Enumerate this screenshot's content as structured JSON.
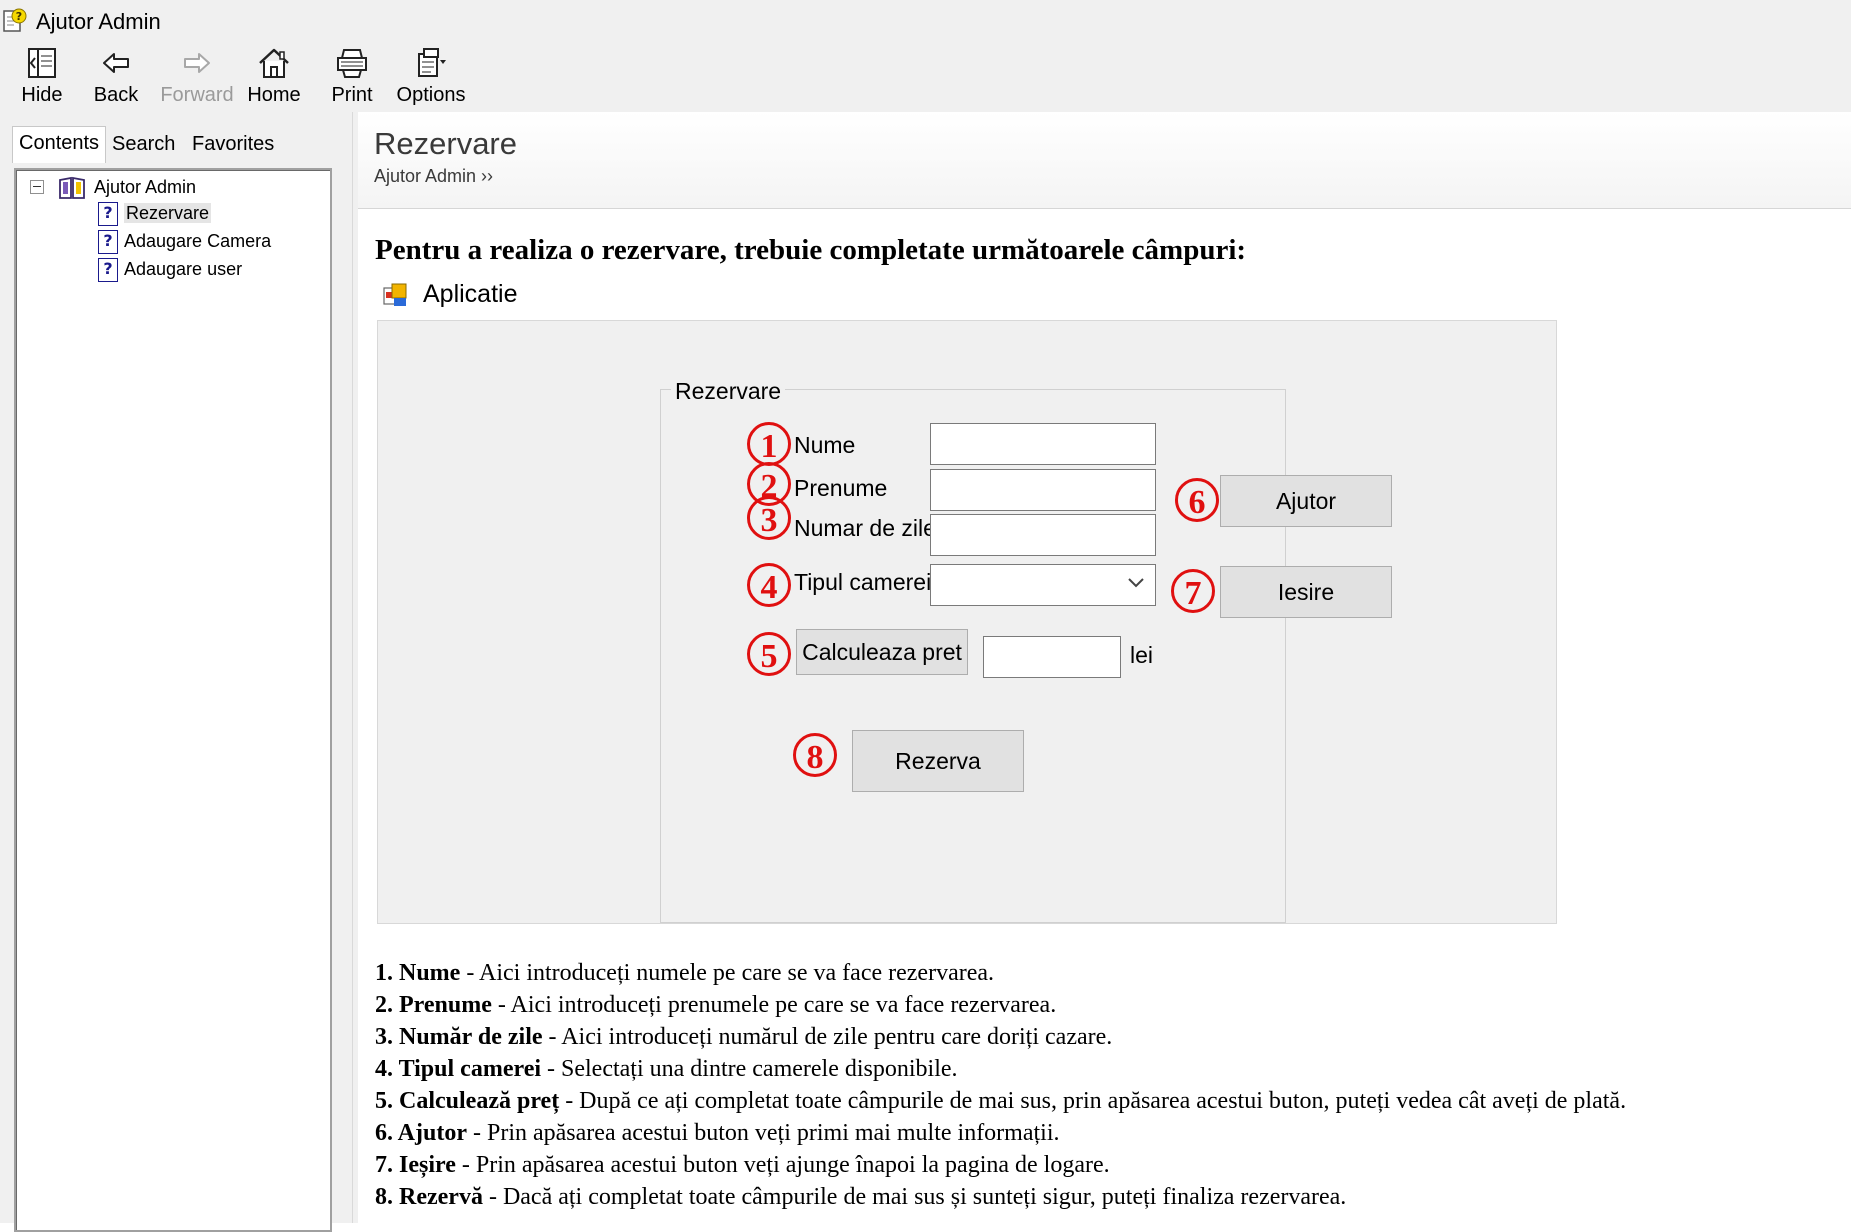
{
  "window": {
    "title": "Ajutor Admin"
  },
  "toolbar": {
    "hide": "Hide",
    "back": "Back",
    "forward": "Forward",
    "home": "Home",
    "print": "Print",
    "options": "Options"
  },
  "nav": {
    "tabs": [
      "Contents",
      "Search",
      "Favorites"
    ],
    "tree": {
      "root": "Ajutor Admin",
      "items": [
        "Rezervare",
        "Adaugare Camera",
        "Adaugare user"
      ]
    }
  },
  "content": {
    "title": "Rezervare",
    "breadcrumb": "Ajutor Admin ››",
    "heading": "Pentru a realiza o rezervare, trebuie completate următoarele câmpuri:",
    "screenshot": {
      "window_title": "Aplicatie",
      "group_label": "Rezervare",
      "labels": {
        "nume": "Nume",
        "prenume": "Prenume",
        "zile": "Numar de zile",
        "tip": "Tipul camerei",
        "lei": "lei"
      },
      "buttons": {
        "calc": "Calculeaza pret",
        "ajutor": "Ajutor",
        "iesire": "Iesire",
        "rezerva": "Rezerva"
      },
      "markers": [
        "1",
        "2",
        "3",
        "4",
        "5",
        "6",
        "7",
        "8"
      ]
    },
    "descriptions": [
      {
        "term": "1. Nume",
        "text": " - Aici introduceți numele pe care se va face rezervarea."
      },
      {
        "term": "2. Prenume",
        "text": " - Aici introduceți prenumele pe care se va face rezervarea."
      },
      {
        "term": "3. Număr de zile",
        "text": " - Aici introduceți numărul de zile pentru care doriți cazare."
      },
      {
        "term": "4. Tipul camerei",
        "text": " - Selectați una dintre camerele disponibile."
      },
      {
        "term": "5. Calculează preț",
        "text": " - După ce ați completat toate câmpurile de mai sus, prin apăsarea acestui buton, puteți vedea cât aveți de plată."
      },
      {
        "term": "6. Ajutor",
        "text": " - Prin apăsarea acestui buton veți primi mai multe informații."
      },
      {
        "term": "7. Ieșire",
        "text": " - Prin apăsarea acestui buton veți ajunge înapoi la pagina de logare."
      },
      {
        "term": "8. Rezervă",
        "text": " - Dacă ați completat toate câmpurile de mai sus și sunteți sigur, puteți finaliza rezervarea."
      }
    ]
  },
  "colors": {
    "marker": "#e01010",
    "chrome": "#f0f0f0",
    "button": "#e1e1e1"
  }
}
